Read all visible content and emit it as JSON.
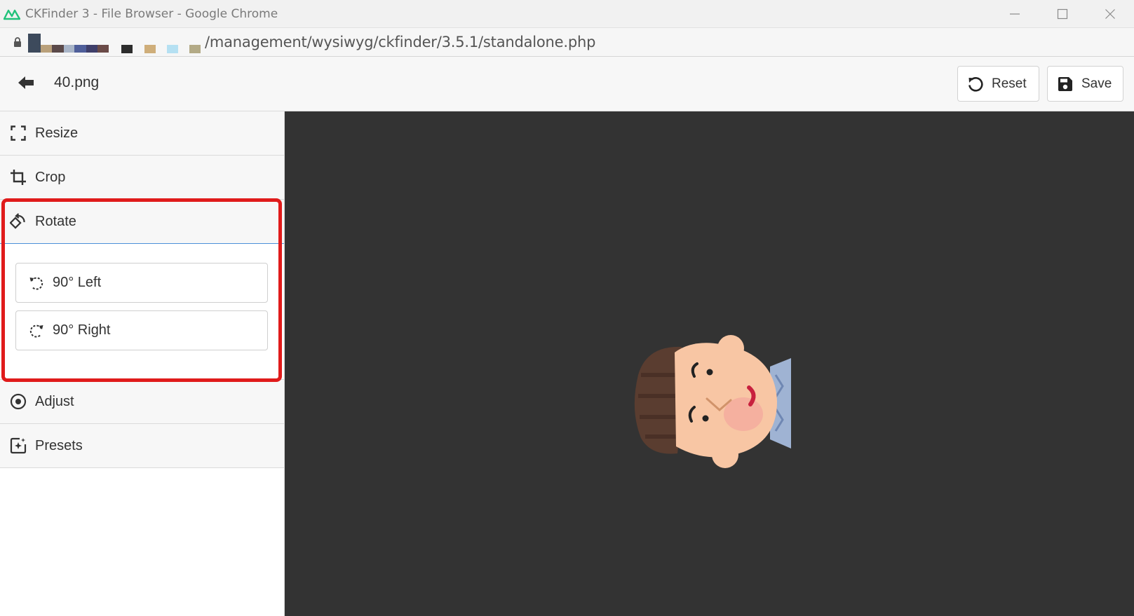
{
  "browser": {
    "window_title": "CKFinder 3 - File Browser - Google Chrome",
    "url": "/management/wysiwyg/ckfinder/3.5.1/standalone.php"
  },
  "header": {
    "filename": "40.png",
    "reset_label": "Reset",
    "save_label": "Save"
  },
  "sidebar": {
    "items": [
      {
        "label": "Resize",
        "icon": "resize-icon"
      },
      {
        "label": "Crop",
        "icon": "crop-icon"
      },
      {
        "label": "Rotate",
        "icon": "rotate-icon",
        "expanded": true
      },
      {
        "label": "Adjust",
        "icon": "adjust-icon"
      },
      {
        "label": "Presets",
        "icon": "presets-icon"
      }
    ],
    "rotate": {
      "left_label": "90° Left",
      "right_label": "90° Right"
    }
  },
  "colors": {
    "canvas_bg": "#333333",
    "highlight": "#e01b1b",
    "active_border": "#4a90d9"
  }
}
